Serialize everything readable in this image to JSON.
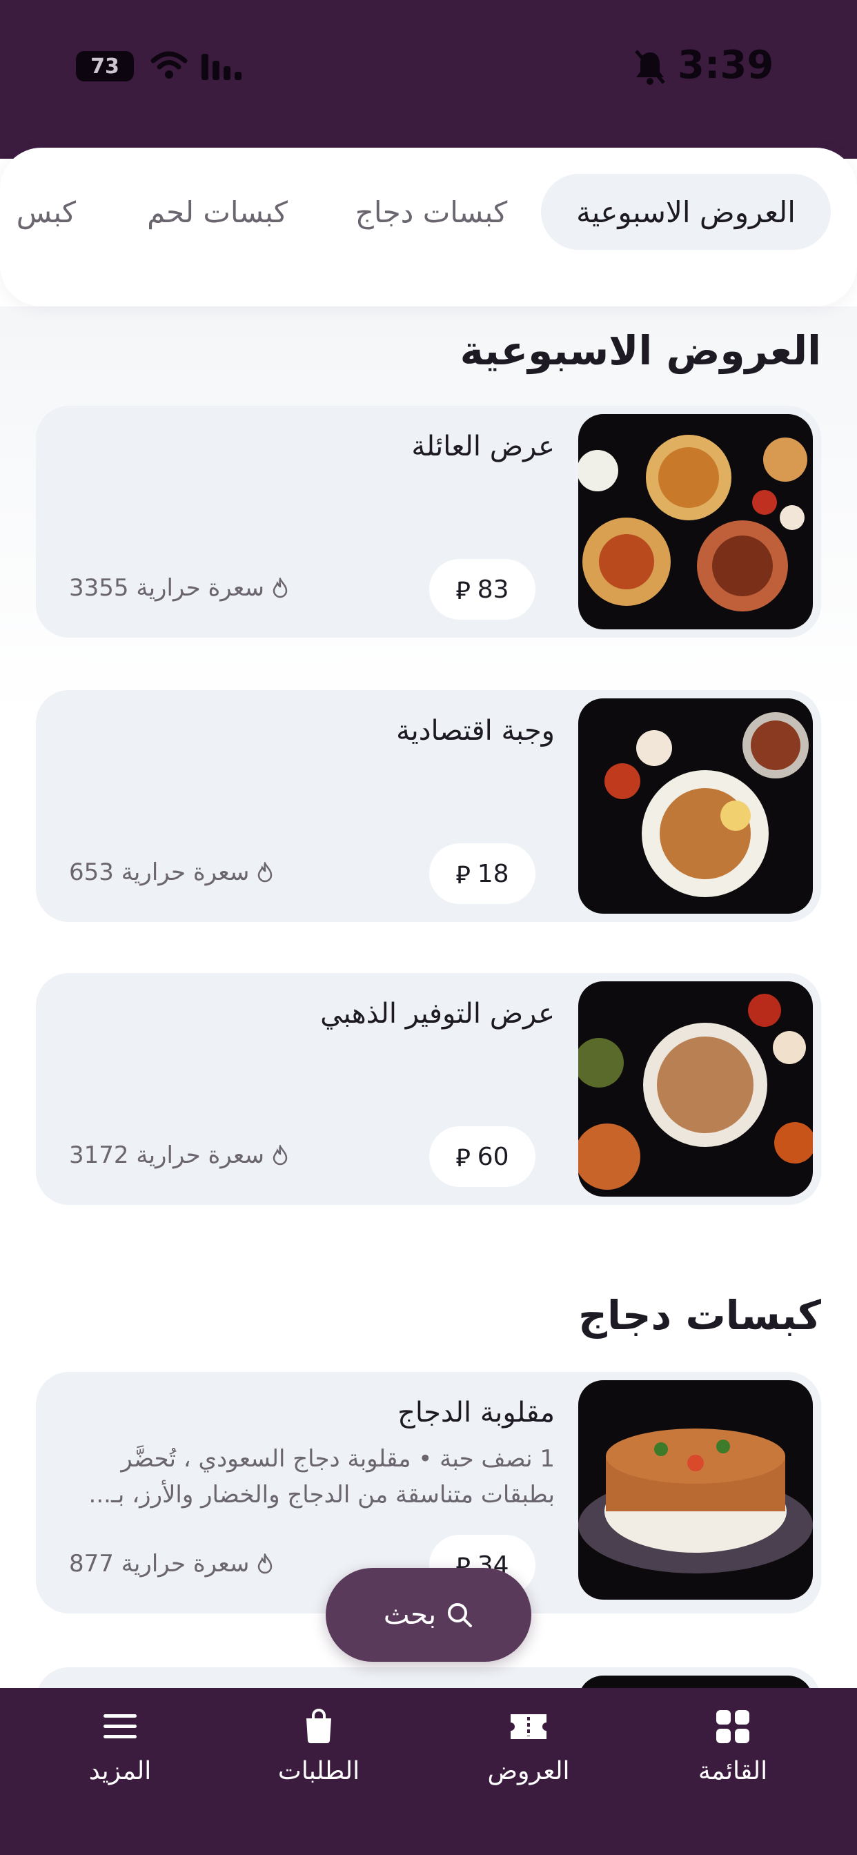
{
  "status_bar": {
    "battery": "73",
    "time": "3:39"
  },
  "tabs": [
    {
      "label": "العروض الاسبوعية",
      "active": true
    },
    {
      "label": "كبسات دجاج",
      "active": false
    },
    {
      "label": "كبسات لحم",
      "active": false
    },
    {
      "label": "كبس",
      "active": false
    }
  ],
  "sections": [
    {
      "title": "العروض الاسبوعية",
      "items": [
        {
          "name": "عرض العائلة",
          "price": "83",
          "calories": "3355 سعرة حرارية"
        },
        {
          "name": "وجبة اقتصادية",
          "price": "18",
          "calories": "653 سعرة حرارية"
        },
        {
          "name": "عرض التوفير الذهبي",
          "price": "60",
          "calories": "3172 سعرة حرارية"
        }
      ]
    },
    {
      "title": "كبسات دجاج",
      "items": [
        {
          "name": "مقلوبة الدجاج",
          "description": "1 نصف حبة • مقلوبة دجاج السعودي ، تُحضَّر بطبقات متناسقة من الدجاج والخضار والأرز، بـ...",
          "price": "34",
          "calories": "877 سعرة حرارية"
        }
      ]
    }
  ],
  "currency_symbol": "⃁",
  "search_button": {
    "label": "بحث"
  },
  "bottom_nav": [
    {
      "label": "القائمة",
      "icon": "grid-icon"
    },
    {
      "label": "العروض",
      "icon": "ticket-icon"
    },
    {
      "label": "الطلبات",
      "icon": "bag-icon"
    },
    {
      "label": "المزيد",
      "icon": "menu-icon"
    }
  ],
  "colors": {
    "brand": "#3b1c3f",
    "search_button": "#5a3a5a",
    "card_bg": "#eef1f5",
    "active_tab_bg": "#eef1f5"
  }
}
